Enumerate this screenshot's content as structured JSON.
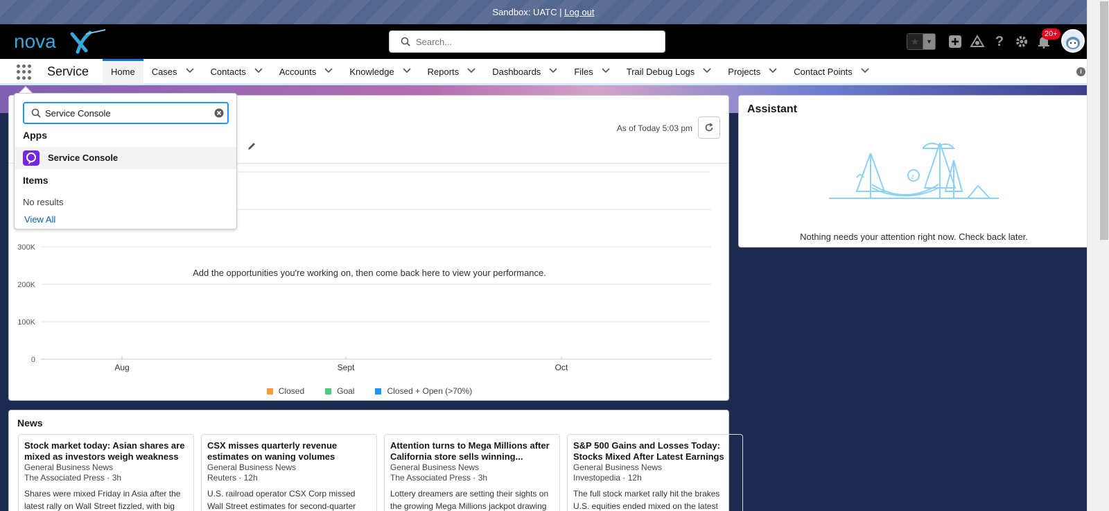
{
  "sandbox": {
    "text": "Sandbox: UATC |",
    "logout": "Log out"
  },
  "header": {
    "logo_text": "novaX",
    "search_placeholder": "Search...",
    "notification_badge": "20+"
  },
  "nav": {
    "app_name": "Service",
    "items": [
      {
        "label": "Home",
        "active": true,
        "dropdown": false
      },
      {
        "label": "Cases",
        "dropdown": true
      },
      {
        "label": "Contacts",
        "dropdown": true
      },
      {
        "label": "Accounts",
        "dropdown": true
      },
      {
        "label": "Knowledge",
        "dropdown": true
      },
      {
        "label": "Reports",
        "dropdown": true
      },
      {
        "label": "Dashboards",
        "dropdown": true
      },
      {
        "label": "Files",
        "dropdown": true
      },
      {
        "label": "Trail Debug Logs",
        "dropdown": true
      },
      {
        "label": "Projects",
        "dropdown": true
      },
      {
        "label": "Contact Points",
        "dropdown": true
      }
    ],
    "info": "i"
  },
  "launcher": {
    "search_value": "Service Console",
    "apps_heading": "Apps",
    "app_result": "Service Console",
    "items_heading": "Items",
    "no_results": "No results",
    "view_all": "View All"
  },
  "performance": {
    "as_of": "As of Today 5:03 pm",
    "empty_message": "Add the opportunities you're working on, then come back here to view your performance."
  },
  "chart_data": {
    "type": "line",
    "x": [
      "Aug",
      "Sept",
      "Oct"
    ],
    "y_ticks": [
      "0",
      "100K",
      "200K",
      "300K"
    ],
    "ylim": [
      0,
      300000
    ],
    "series": [
      {
        "name": "Closed",
        "color": "#ff9a3c",
        "values": []
      },
      {
        "name": "Goal",
        "color": "#4bca81",
        "values": []
      },
      {
        "name": "Closed + Open (>70%)",
        "color": "#1b96ff",
        "values": []
      }
    ],
    "grid": true,
    "legend": "bottom"
  },
  "assistant": {
    "title": "Assistant",
    "message": "Nothing needs your attention right now. Check back later."
  },
  "news": {
    "title": "News",
    "items": [
      {
        "headline": "Stock market today: Asian shares are mixed as investors weigh weakness i...",
        "category": "General Business News",
        "source": "The Associated Press · 3h",
        "body": "Shares were mixed Friday in Asia after the latest rally on Wall Street fizzled, with big"
      },
      {
        "headline": "CSX misses quarterly revenue estimates on waning volumes",
        "category": "General Business News",
        "source": "Reuters · 12h",
        "body": "U.S. railroad operator CSX Corp missed Wall Street estimates for second-quarter revenue"
      },
      {
        "headline": "Attention turns to Mega Millions after California store sells winning...",
        "category": "General Business News",
        "source": "The Associated Press · 3h",
        "body": "Lottery dreamers are setting their sights on the growing Mega Millions jackpot drawing"
      },
      {
        "headline": "S&P 500 Gains and Losses Today: Stocks Mixed After Latest Earnings",
        "category": "General Business News",
        "source": "Investopedia · 12h",
        "body": "The full stock market rally hit the brakes U.S. equities ended mixed on the latest"
      }
    ]
  }
}
